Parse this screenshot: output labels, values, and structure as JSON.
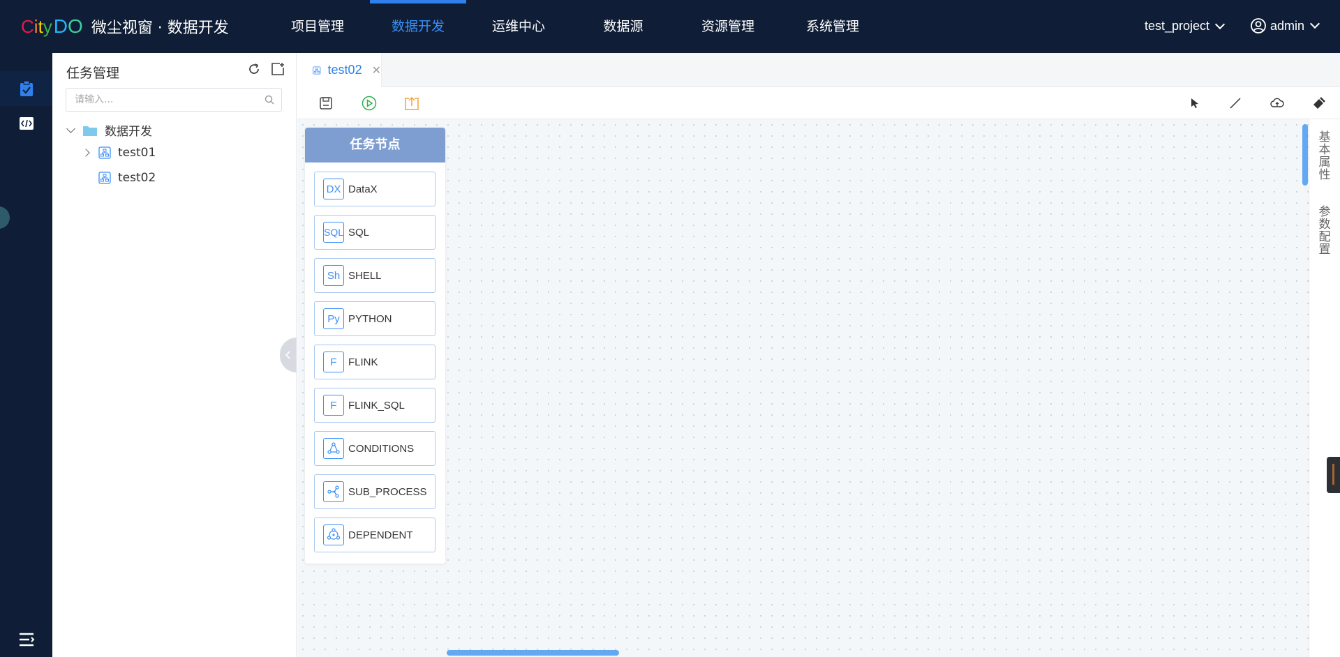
{
  "header": {
    "logo_city": [
      "C",
      "i",
      "t",
      "y"
    ],
    "logo_do": [
      "D",
      "O"
    ],
    "title": "微尘视窗 · 数据开发",
    "nav": [
      {
        "label": "项目管理",
        "active": false
      },
      {
        "label": "数据开发",
        "active": true
      },
      {
        "label": "运维中心",
        "active": false
      },
      {
        "label": "数据源",
        "active": false
      },
      {
        "label": "资源管理",
        "active": false
      },
      {
        "label": "系统管理",
        "active": false
      }
    ],
    "project": "test_project",
    "user": "admin"
  },
  "rail": {
    "items": [
      {
        "icon": "task-clipboard-icon",
        "active": true
      },
      {
        "icon": "code-icon",
        "active": false
      }
    ],
    "bottom_icon": "menu-collapse-icon"
  },
  "tree_panel": {
    "title": "任务管理",
    "tools": [
      "refresh-icon",
      "new-folder-icon"
    ],
    "search_placeholder": "请输入...",
    "folder": "数据开发",
    "items": [
      "test01",
      "test02"
    ]
  },
  "editor": {
    "tab": "test02",
    "toolbar_left": [
      "save-icon",
      "run-icon",
      "publish-icon"
    ],
    "toolbar_right": [
      "pointer-icon",
      "line-icon",
      "cloud-icon",
      "format-icon"
    ],
    "palette": {
      "title": "任务节点",
      "nodes": [
        {
          "icon_text": "DX",
          "label": "DataX"
        },
        {
          "icon_text": "SQL",
          "label": "SQL"
        },
        {
          "icon_text": "Sh",
          "label": "SHELL"
        },
        {
          "icon_text": "Py",
          "label": "PYTHON"
        },
        {
          "icon_text": "F",
          "label": "FLINK"
        },
        {
          "icon_text": "F",
          "label": "FLINK_SQL"
        },
        {
          "icon_text": "",
          "label": "CONDITIONS"
        },
        {
          "icon_text": "",
          "label": "SUB_PROCESS"
        },
        {
          "icon_text": "",
          "label": "DEPENDENT"
        }
      ]
    },
    "side_tabs": [
      "基本属性",
      "参数配置"
    ]
  },
  "colors": {
    "nav_bg": "#0f1e36",
    "accent": "#2f80ed",
    "palette_header": "#7e9ed1",
    "run": "#2db34a",
    "publish": "#f0a23a"
  }
}
